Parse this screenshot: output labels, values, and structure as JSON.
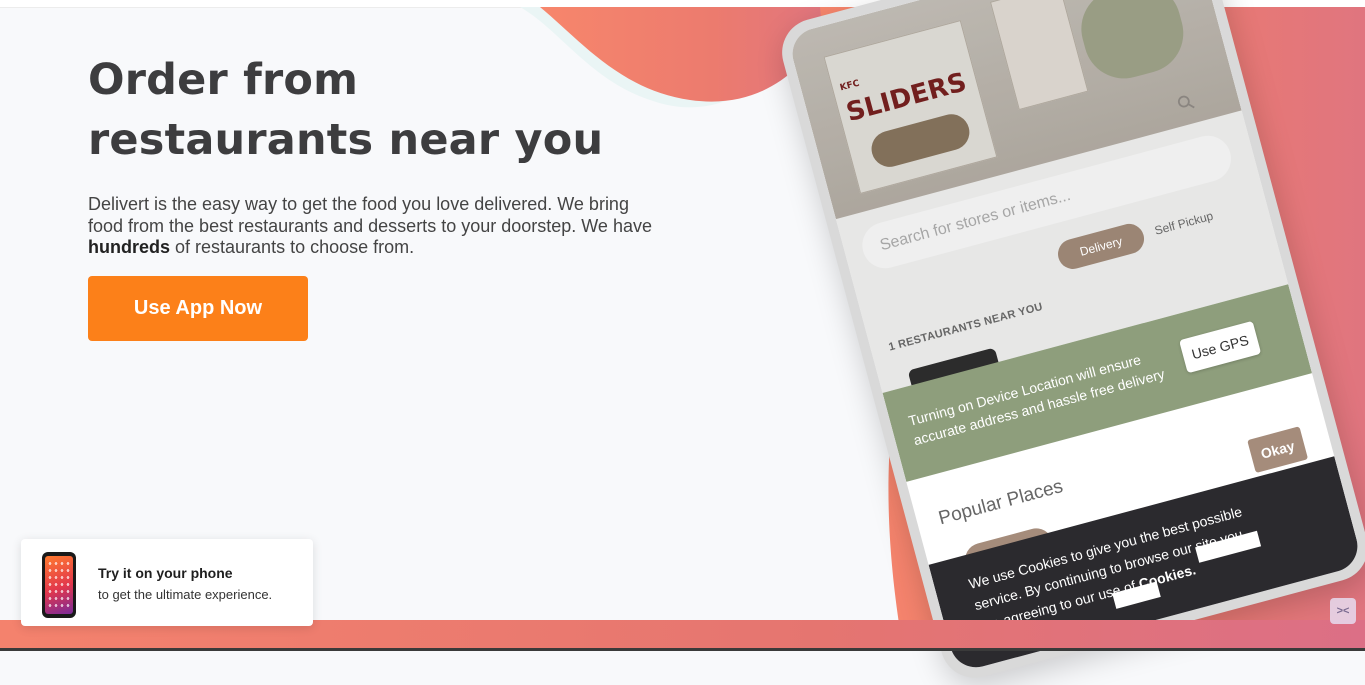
{
  "hero": {
    "title_line1": "Order from",
    "title_line2": "restaurants near you",
    "desc_part1": "Delivert is the easy way to get the food you love delivered. We bring food from the best restaurants and desserts to your doorstep. We have ",
    "desc_bold": "hundreds",
    "desc_part2": " of restaurants to choose from.",
    "cta_label": "Use App Now"
  },
  "try_card": {
    "title": "Try it on your phone",
    "subtitle": "to get the ultimate experience."
  },
  "phone": {
    "promo_brand": "KFC",
    "promo_title": "SLIDERS",
    "search_placeholder": "Search for stores or items...",
    "delivery_label": "Delivery",
    "self_pickup_label": "Self Pickup",
    "restaurants_near": "1 RESTAURANTS NEAR YOU",
    "gps_message": "Turning on Device Location will ensure accurate address and hassle free delivery",
    "gps_button": "Use GPS",
    "popular_places": "Popular Places",
    "okay_button": "Okay",
    "cookie_part1": "We use Cookies to give you the best possible service. By continuing to browse our site you are agreeing to our use of ",
    "cookie_bold": "Cookies."
  },
  "corner_button": "><",
  "colors": {
    "accent": "#fc8019",
    "heading": "#3d3d3f",
    "blob": "#f4826d",
    "gps_banner": "#8e9e7c",
    "cookie_bar": "#2b2a2e"
  },
  "icons": [
    "search-icon",
    "phone-thumbnail-icon",
    "collapse-icon"
  ]
}
